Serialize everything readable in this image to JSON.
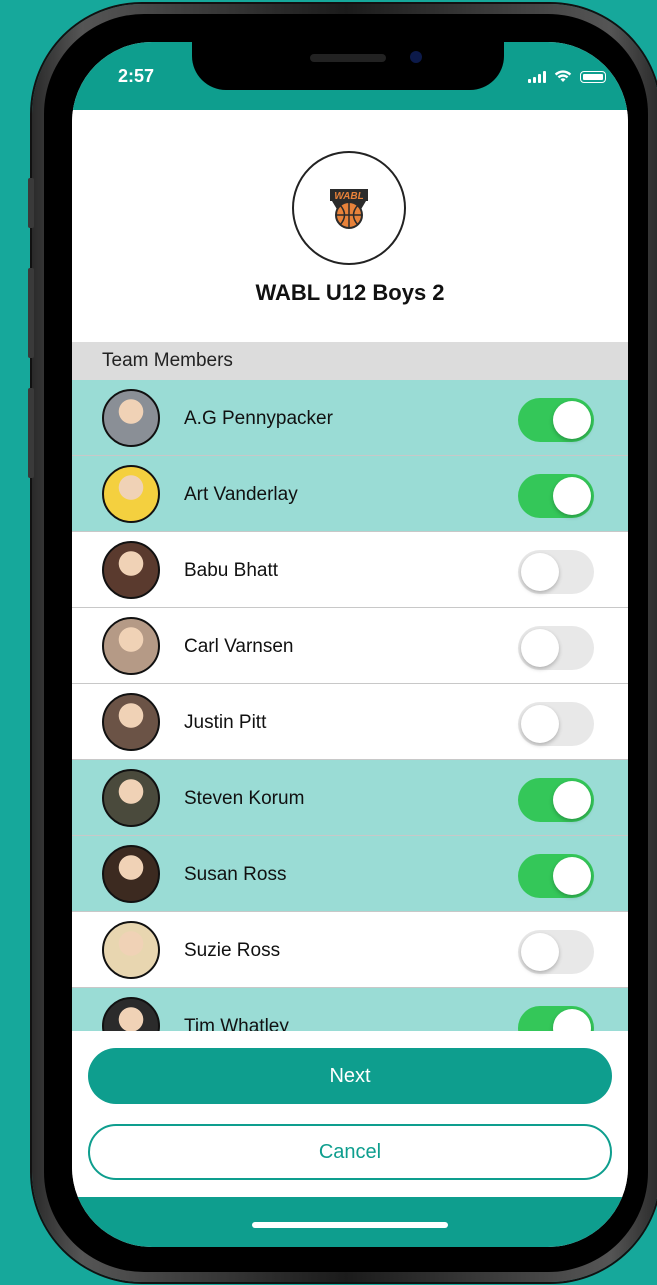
{
  "status_bar": {
    "time": "2:57",
    "signal_icon": "cellular-signal-icon",
    "wifi_icon": "wifi-icon",
    "battery_icon": "battery-icon"
  },
  "team": {
    "logo_text": "WABL",
    "name": "WABL U12 Boys 2"
  },
  "section": {
    "title": "Team Members"
  },
  "members": [
    {
      "name": "A.G Pennypacker",
      "selected": true,
      "avatar_color": "#8a8f96"
    },
    {
      "name": "Art Vanderlay",
      "selected": true,
      "avatar_color": "#f4d03f"
    },
    {
      "name": "Babu Bhatt",
      "selected": false,
      "avatar_color": "#5a3a2e"
    },
    {
      "name": "Carl Varnsen",
      "selected": false,
      "avatar_color": "#b59a86"
    },
    {
      "name": "Justin Pitt",
      "selected": false,
      "avatar_color": "#6b5346"
    },
    {
      "name": "Steven Korum",
      "selected": true,
      "avatar_color": "#4a4a3c"
    },
    {
      "name": "Susan Ross",
      "selected": true,
      "avatar_color": "#3c2a20"
    },
    {
      "name": "Suzie Ross",
      "selected": false,
      "avatar_color": "#e8d6b0"
    },
    {
      "name": "Tim Whatley",
      "selected": true,
      "avatar_color": "#2b2b2b"
    }
  ],
  "buttons": {
    "next_label": "Next",
    "cancel_label": "Cancel"
  },
  "colors": {
    "background": "#16a89b",
    "brand": "#0e9e8e",
    "selected_row": "#9adcd5",
    "toggle_on": "#34c759",
    "toggle_off": "#e8e8e8"
  }
}
